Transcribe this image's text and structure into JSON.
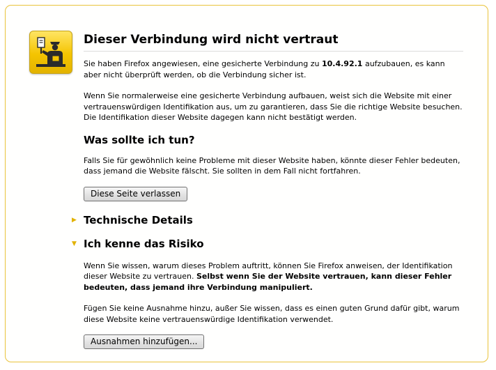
{
  "page": {
    "title": "Dieser Verbindung wird nicht vertraut",
    "intro_prefix": "Sie haben Firefox angewiesen, eine gesicherte Verbindung zu ",
    "host": "10.4.92.1",
    "intro_suffix": " aufzubauen, es kann aber nicht überprüft werden, ob die Verbindung sicher ist.",
    "explanation": "Wenn Sie normalerweise eine gesicherte Verbindung aufbauen, weist sich die Website mit einer vertrauenswürdigen Identifikation aus, um zu garantieren, dass Sie die richtige Website besuchen. Die Identifikation dieser Website dagegen kann nicht bestätigt werden."
  },
  "what_to_do": {
    "heading": "Was sollte ich tun?",
    "text": "Falls Sie für gewöhnlich keine Probleme mit dieser Website haben, könnte dieser Fehler bedeuten, dass jemand die Website fälscht. Sie sollten in dem Fall nicht fortfahren.",
    "leave_button": "Diese Seite verlassen"
  },
  "technical": {
    "heading": "Technische Details",
    "collapsed_marker": "▶"
  },
  "risk": {
    "heading": "Ich kenne das Risiko",
    "expanded_marker": "▼",
    "text_normal": "Wenn Sie wissen, warum dieses Problem auftritt, können Sie Firefox anweisen, der Identifikation dieser Website zu vertrauen. ",
    "text_bold": "Selbst wenn Sie der Website vertrauen, kann dieser Fehler bedeuten, dass jemand ihre Verbindung manipuliert.",
    "exception_text": "Fügen Sie keine Ausnahme hinzu, außer Sie wissen, dass es einen guten Grund dafür gibt, warum diese Website keine vertrauenswürdige Identifikation verwendet.",
    "add_exception_button": "Ausnahmen hinzufügen..."
  },
  "icon": {
    "name": "security-officer-icon",
    "background": "#f4c400"
  }
}
